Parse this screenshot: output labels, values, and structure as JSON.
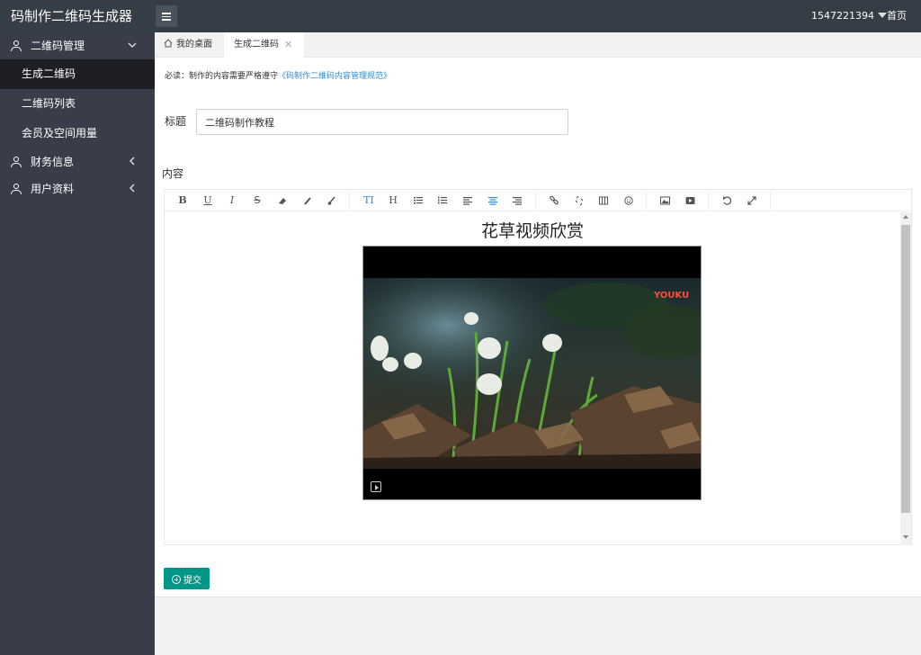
{
  "app": {
    "brand": "码制作二维码生成器"
  },
  "header": {
    "user": "1547221394",
    "home": "首页"
  },
  "sidebar": {
    "groups": [
      {
        "label": "二维码管理",
        "items": [
          "生成二维码",
          "二维码列表",
          "会员及空间用量"
        ]
      },
      {
        "label": "财务信息"
      },
      {
        "label": "用户资料"
      }
    ]
  },
  "tabs": {
    "home": "我的桌面",
    "active": "生成二维码",
    "close_symbol": "✕"
  },
  "form": {
    "notice_prefix": "必读：制作的内容需要严格遵守",
    "notice_link": "《码制作二维码内容管理规范》",
    "title_label": "标题",
    "title_value": "二维码制作教程",
    "content_label": "内容",
    "submit_label": "提交"
  },
  "editor": {
    "toolbar": {
      "bold": "B",
      "underline": "U",
      "italic": "I",
      "strike": "S",
      "font_size": "TI",
      "heading": "H"
    },
    "video_title": "花草视频欣赏",
    "video_watermark": "YOUKU"
  }
}
